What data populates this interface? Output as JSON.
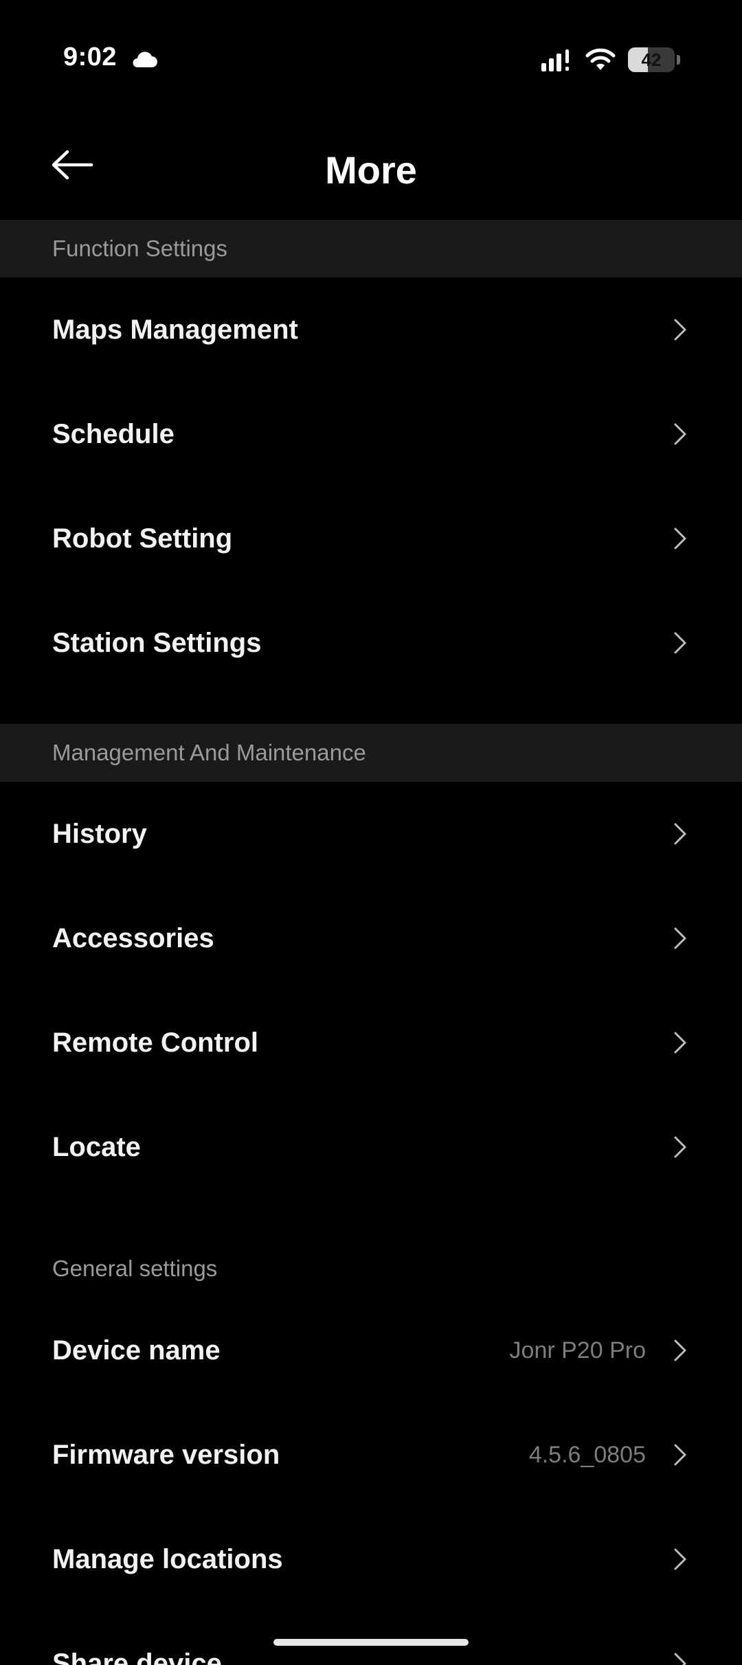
{
  "status_bar": {
    "time": "9:02",
    "battery_level": "42",
    "battery_fraction": 0.42,
    "icons": [
      "cloud-icon",
      "signal-icon",
      "wifi-icon",
      "battery-icon"
    ]
  },
  "header": {
    "title": "More",
    "back_icon": "arrow-left-icon"
  },
  "sections": [
    {
      "title": "Function Settings",
      "items": [
        {
          "label": "Maps Management"
        },
        {
          "label": "Schedule"
        },
        {
          "label": "Robot Setting"
        },
        {
          "label": "Station Settings"
        }
      ]
    },
    {
      "title": "Management And Maintenance",
      "items": [
        {
          "label": "History"
        },
        {
          "label": "Accessories"
        },
        {
          "label": "Remote Control"
        },
        {
          "label": "Locate"
        }
      ]
    },
    {
      "title": "General settings",
      "items": [
        {
          "label": "Device name",
          "value": "Jonr P20 Pro"
        },
        {
          "label": "Firmware version",
          "value": "4.5.6_0805"
        },
        {
          "label": "Manage locations"
        },
        {
          "label": "Share device"
        }
      ]
    }
  ],
  "colors": {
    "background": "#000000",
    "section_header_bg": "#1a1a1a",
    "secondary_text": "#9a9a9a",
    "value_text": "#7d7d7d"
  }
}
